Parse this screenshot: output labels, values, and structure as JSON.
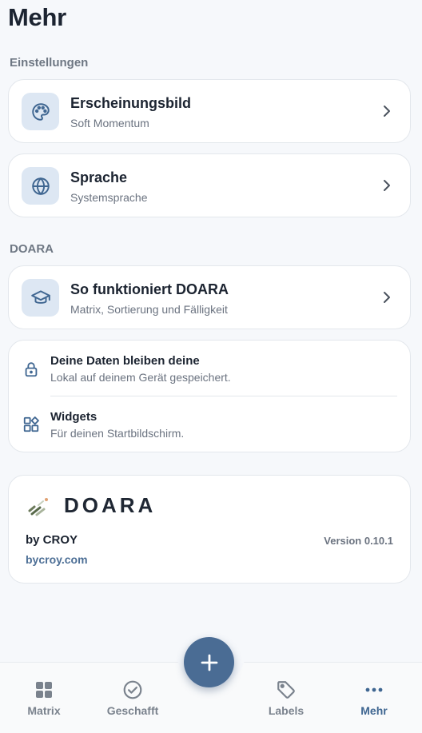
{
  "page": {
    "title": "Mehr"
  },
  "settings": {
    "label": "Einstellungen",
    "appearance": {
      "title": "Erscheinungsbild",
      "subtitle": "Soft Momentum",
      "icon": "palette-icon"
    },
    "language": {
      "title": "Sprache",
      "subtitle": "Systemsprache",
      "icon": "globe-icon"
    }
  },
  "doara": {
    "label": "DOARA",
    "how_it_works": {
      "title": "So funktioniert DOARA",
      "subtitle": "Matrix, Sortierung und Fälligkeit",
      "icon": "graduation-cap-icon"
    },
    "info": [
      {
        "title": "Deine Daten bleiben deine",
        "subtitle": "Lokal auf deinem Gerät gespeichert.",
        "icon": "lock-icon"
      },
      {
        "title": "Widgets",
        "subtitle": "Für deinen Startbildschirm.",
        "icon": "widgets-icon"
      }
    ]
  },
  "brand": {
    "name": "DOARA",
    "by": "by CROY",
    "version": "Version 0.10.1",
    "link": "bycroy.com"
  },
  "nav": {
    "items": [
      {
        "label": "Matrix",
        "icon": "grid-icon",
        "active": false
      },
      {
        "label": "Geschafft",
        "icon": "check-circle-icon",
        "active": false
      },
      {
        "label": "Labels",
        "icon": "tag-icon",
        "active": false
      },
      {
        "label": "Mehr",
        "icon": "more-dots-icon",
        "active": true
      }
    ],
    "fab_icon": "plus-icon"
  },
  "colors": {
    "accent": "#4a6c94",
    "icon_bg": "#dde7f3",
    "active_nav": "#3f6691",
    "link": "#4d6f96"
  }
}
